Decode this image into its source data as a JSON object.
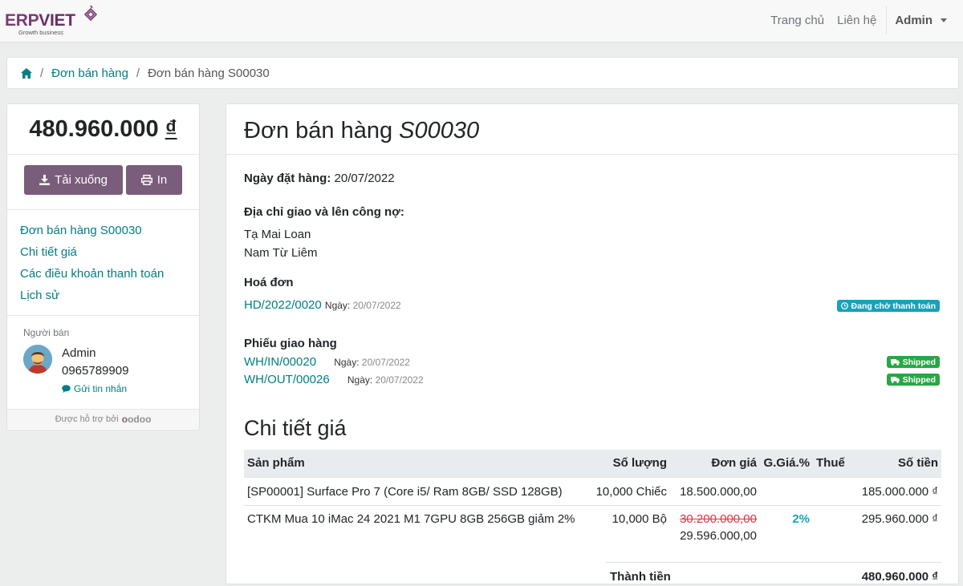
{
  "brand": {
    "name_part1": "ERP",
    "name_part2": "VIET",
    "tagline": "Growth business",
    "brand_color": "#7a3a73"
  },
  "nav": {
    "home": "Trang chủ",
    "contact": "Liên hệ",
    "user": "Admin"
  },
  "breadcrumb": {
    "items": [
      "Đơn bán hàng"
    ],
    "current": "Đơn bán hàng S00030"
  },
  "sidebar": {
    "total": "480.960.000",
    "currency": "₫",
    "download_label": "Tải xuống",
    "print_label": "In",
    "toc": [
      "Đơn bán hàng S00030",
      "Chi tiết giá",
      "Các điều khoản thanh toán",
      "Lịch sử"
    ],
    "seller_title": "Người bán",
    "seller_name": "Admin",
    "seller_phone": "0965789909",
    "send_message": "Gửi tin nhắn",
    "powered_by": "Được hỗ trợ bởi",
    "powered_brand": "odoo"
  },
  "order": {
    "title_prefix": "Đơn bán hàng",
    "title_ref": "S00030",
    "order_date_label": "Ngày đặt hàng:",
    "order_date": "20/07/2022",
    "address_label": "Địa chỉ giao và lên công nợ:",
    "address_name": "Tạ Mai Loan",
    "address_line": "Nam Từ Liêm",
    "invoice_label": "Hoá đơn",
    "invoice": {
      "ref": "HD/2022/0020",
      "date_label": "Ngày:",
      "date": "20/07/2022",
      "status": "Đang chờ thanh toán"
    },
    "delivery_label": "Phiếu giao hàng",
    "deliveries": [
      {
        "ref": "WH/IN/00020",
        "date_label": "Ngày:",
        "date": "20/07/2022",
        "status": "Shipped"
      },
      {
        "ref": "WH/OUT/00026",
        "date_label": "Ngày:",
        "date": "20/07/2022",
        "status": "Shipped"
      }
    ]
  },
  "pricing": {
    "title": "Chi tiết giá",
    "headers": [
      "Sản phẩm",
      "Số lượng",
      "Đơn giá",
      "G.Giá.%",
      "Thuế",
      "Số tiền"
    ],
    "rows": [
      {
        "product": "[SP00001] Surface Pro 7 (Core i5/ Ram 8GB/ SSD 128GB)",
        "qty": "10,000 Chiếc",
        "unit_price": "18.500.000,00",
        "old_price": "",
        "discount": "",
        "tax": "",
        "amount": "185.000.000 ₫"
      },
      {
        "product": "CTKM Mua 10 iMac 24 2021 M1 7GPU 8GB 256GB giảm 2%",
        "qty": "10,000 Bộ",
        "unit_price": "29.596.000,00",
        "old_price": "30.200.000,00",
        "discount": "2%",
        "tax": "",
        "amount": "295.960.000 ₫"
      }
    ],
    "subtotal_label": "Thành tiền",
    "subtotal_value": "480.960.000 ₫"
  },
  "colors": {
    "link": "#017e84",
    "button": "#7a5c7b",
    "info": "#17a2b8",
    "success": "#28a745"
  }
}
